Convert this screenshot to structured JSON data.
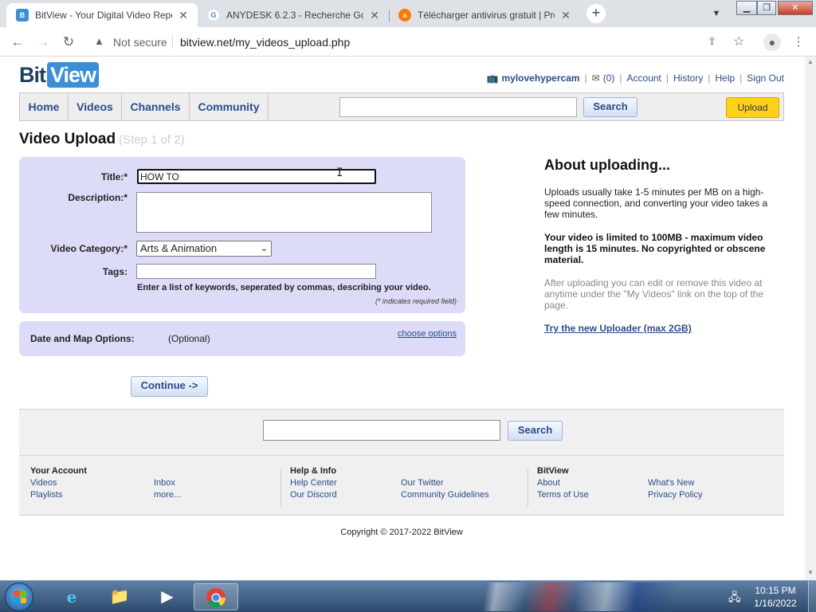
{
  "browser": {
    "tabs": [
      {
        "title": "BitView - Your Digital Video Repo",
        "favicon": "bitview-favicon",
        "active": true
      },
      {
        "title": "ANYDESK 6.2.3 - Recherche Goo",
        "favicon": "google-favicon",
        "active": false
      },
      {
        "title": "Télécharger antivirus gratuit | Pro",
        "favicon": "avast-favicon",
        "active": false
      }
    ],
    "security_label": "Not secure",
    "url": "bitview.net/my_videos_upload.php"
  },
  "site": {
    "logo_bit": "Bit",
    "logo_view": "View",
    "userbar": {
      "username": "mylovehypercam",
      "inbox_count": "(0)",
      "links": [
        "Account",
        "History",
        "Help",
        "Sign Out"
      ]
    },
    "nav": [
      "Home",
      "Videos",
      "Channels",
      "Community"
    ],
    "search_button": "Search",
    "upload_button": "Upload"
  },
  "upload": {
    "heading": "Video Upload",
    "step": "(Step 1 of 2)",
    "title_label": "Title:*",
    "title_value": "HOW TO",
    "description_label": "Description:*",
    "category_label": "Video Category:*",
    "category_value": "Arts & Animation",
    "tags_label": "Tags:",
    "tags_hint": "Enter a list of keywords, seperated by commas, describing your video.",
    "required_hint": "(* indicates required field)",
    "map_label": "Date and Map Options:",
    "map_optional": "(Optional)",
    "map_link": "choose options",
    "continue_button": "Continue ->"
  },
  "about": {
    "title": "About uploading...",
    "p1": "Uploads usually take 1-5 minutes per MB on a high-speed connection, and converting your video takes a few minutes.",
    "p2": "Your video is limited to 100MB - maximum video length is 15 minutes. No copyrighted or obscene material.",
    "p3": "After uploading you can edit or remove this video at anytime under the \"My Videos\" link on the top of the page.",
    "link": "Try the new Uploader (max 2GB)"
  },
  "footer": {
    "search_button": "Search",
    "col1": {
      "heading": "Your Account",
      "links_a": [
        "Videos",
        "Playlists"
      ],
      "links_b": [
        "Inbox",
        "more..."
      ]
    },
    "col2": {
      "heading": "Help & Info",
      "links_a": [
        "Help Center",
        "Our Discord"
      ],
      "links_b": [
        "Our Twitter",
        "Community Guidelines"
      ]
    },
    "col3": {
      "heading": "BitView",
      "links_a": [
        "About",
        "Terms of Use"
      ],
      "links_b": [
        "What's New",
        "Privacy Policy"
      ]
    },
    "copyright": "Copyright © 2017-2022 BitView"
  },
  "taskbar": {
    "time": "10:15 PM",
    "date": "1/16/2022"
  },
  "colors": {
    "link_blue": "#2b4c89",
    "form_bg": "#dcdcf8",
    "upload_yellow": "#ffd21a",
    "logo_blue": "#3a8fd6"
  }
}
